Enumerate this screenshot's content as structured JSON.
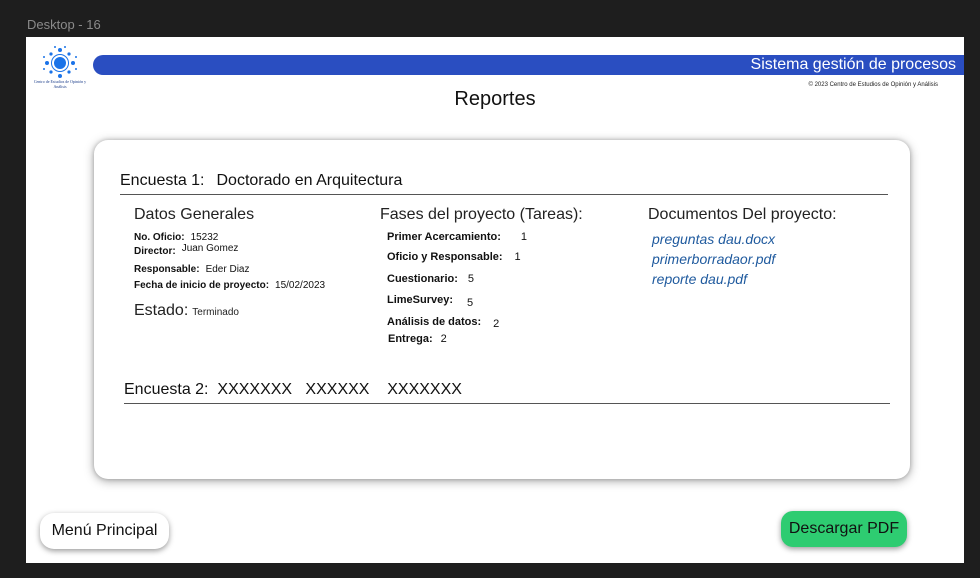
{
  "frame": {
    "label": "Desktop - 16"
  },
  "header": {
    "logo_text": "Centro de Estudios de Opinión y Análisis",
    "system_title": "Sistema gestión de procesos",
    "copyright": "© 2023 Centro de Estudios de Opinión y Análisis",
    "page_title": "Reportes"
  },
  "survey1": {
    "label": "Encuesta 1:",
    "name": "Doctorado en Arquitectura",
    "general": {
      "heading": "Datos Generales",
      "fields": [
        {
          "key": "No. Oficio:",
          "value": "15232"
        },
        {
          "key": "Director:",
          "value": "Juan Gomez"
        },
        {
          "key": "Responsable:",
          "value": "Eder Diaz"
        },
        {
          "key": "Fecha de inicio de proyecto:",
          "value": "15/02/2023"
        }
      ],
      "status_label": "Estado:",
      "status_value": "Terminado"
    },
    "phases": {
      "heading": "Fases del proyecto (Tareas):",
      "tasks": [
        {
          "key": "Primer Acercamiento:",
          "value": "1"
        },
        {
          "key": "Oficio y Responsable:",
          "value": "1"
        },
        {
          "key": "Cuestionario:",
          "value": "5"
        },
        {
          "key": "LimeSurvey:",
          "value": "5"
        },
        {
          "key": "Análisis de datos:",
          "value": "2"
        },
        {
          "key": "Entrega:",
          "value": "2"
        }
      ]
    },
    "documents": {
      "heading": "Documentos Del proyecto:",
      "files": [
        "preguntas dau.docx",
        "primerborradaor.pdf",
        "reporte dau.pdf"
      ]
    }
  },
  "survey2": {
    "text": "Encuesta 2:  XXXXXXX   XXXXXX    XXXXXXX"
  },
  "buttons": {
    "menu": "Menú Principal",
    "pdf": "Descargar PDF"
  },
  "colors": {
    "topbar": "#2a4ec1",
    "pdf_button": "#2ecc71",
    "link": "#1f5a9e"
  }
}
